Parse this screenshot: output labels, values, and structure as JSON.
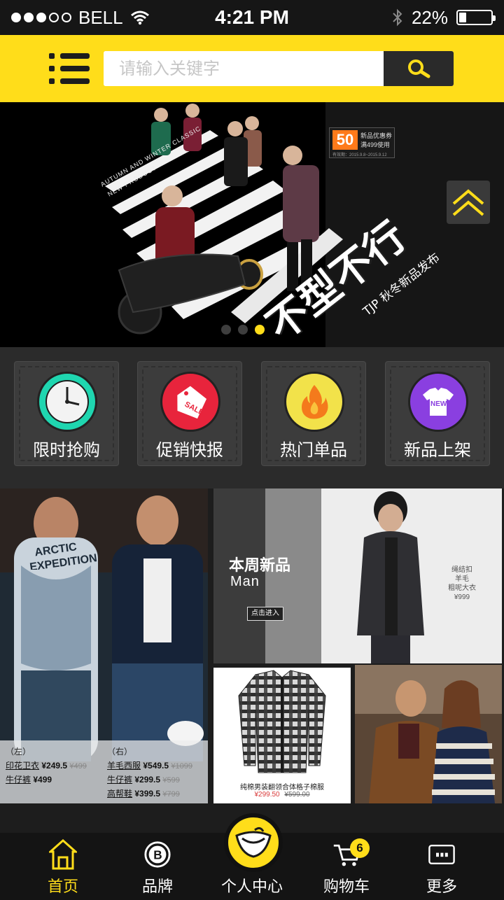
{
  "status_bar": {
    "carrier": "BELL",
    "time": "4:21 PM",
    "battery": "22%",
    "battery_level": 0.22,
    "icons": [
      "signal-dots-icon",
      "wifi-icon",
      "bluetooth-icon",
      "battery-icon"
    ]
  },
  "header": {
    "menu_icon": "list-menu-icon",
    "search": {
      "placeholder": "请输入关键字",
      "value": ""
    },
    "search_icon": "search-icon"
  },
  "banner": {
    "coupon": {
      "amount": "50",
      "line1": "新品优惠券",
      "line2": "满499使用",
      "validity": "有效期：2015.9.8~2015.9.12"
    },
    "english_line1": "AUTUMN AND WINTER CLASSIC",
    "english_line2": "NEW PRODUCT",
    "title": "不型不行",
    "subtitle": "TJP 秋冬新品发布",
    "page_count": 3,
    "active_page": 3,
    "scroll_top_icon": "double-chevron-up-icon"
  },
  "categories": [
    {
      "label": "限时抢购",
      "icon": "clock-icon",
      "color": "#1fd6b0"
    },
    {
      "label": "促销快报",
      "icon": "sale-tag-icon",
      "color": "#e8243c"
    },
    {
      "label": "热门单品",
      "icon": "flame-icon",
      "color": "#f2e24a"
    },
    {
      "label": "新品上架",
      "icon": "new-tshirt-icon",
      "color": "#8a3fe0"
    }
  ],
  "products": {
    "feature_left": {
      "left_tag": "（左）",
      "right_tag": "（右）",
      "left_items": [
        {
          "name": "印花卫衣",
          "price": "¥249.5",
          "old": "¥499"
        },
        {
          "name": "牛仔裤",
          "price": "¥499",
          "old": ""
        }
      ],
      "right_items": [
        {
          "name": "羊毛西服",
          "price": "¥549.5",
          "old": "¥1099"
        },
        {
          "name": "牛仔裤",
          "price": "¥299.5",
          "old": "¥599"
        },
        {
          "name": "高帮鞋",
          "price": "¥399.5",
          "old": "¥799"
        }
      ],
      "shirt_text": "ARCTIC EXPEDITION"
    },
    "weekly_new": {
      "title": "本周新品",
      "subtitle": "Man",
      "button": "点击进入",
      "desc_lines": [
        "绳结扣",
        "羊毛",
        "粗呢大衣",
        "¥999"
      ]
    },
    "shirt_item": {
      "name": "纯棉男装翻领合体格子棉服",
      "price": "¥299.50",
      "old_price": "¥599.00"
    }
  },
  "tabbar": {
    "items": [
      {
        "label": "首页",
        "icon": "home-icon",
        "active": true
      },
      {
        "label": "品牌",
        "icon": "brand-b-icon",
        "active": false
      },
      {
        "label": "个人中心",
        "icon": "profile-center-icon",
        "active": false
      },
      {
        "label": "购物车",
        "icon": "cart-icon",
        "active": false,
        "badge": "6"
      },
      {
        "label": "更多",
        "icon": "more-icon",
        "active": false
      }
    ]
  },
  "colors": {
    "accent": "#ffdd1a",
    "dark": "#1d1d1d",
    "tile": "#3c3c3c"
  }
}
